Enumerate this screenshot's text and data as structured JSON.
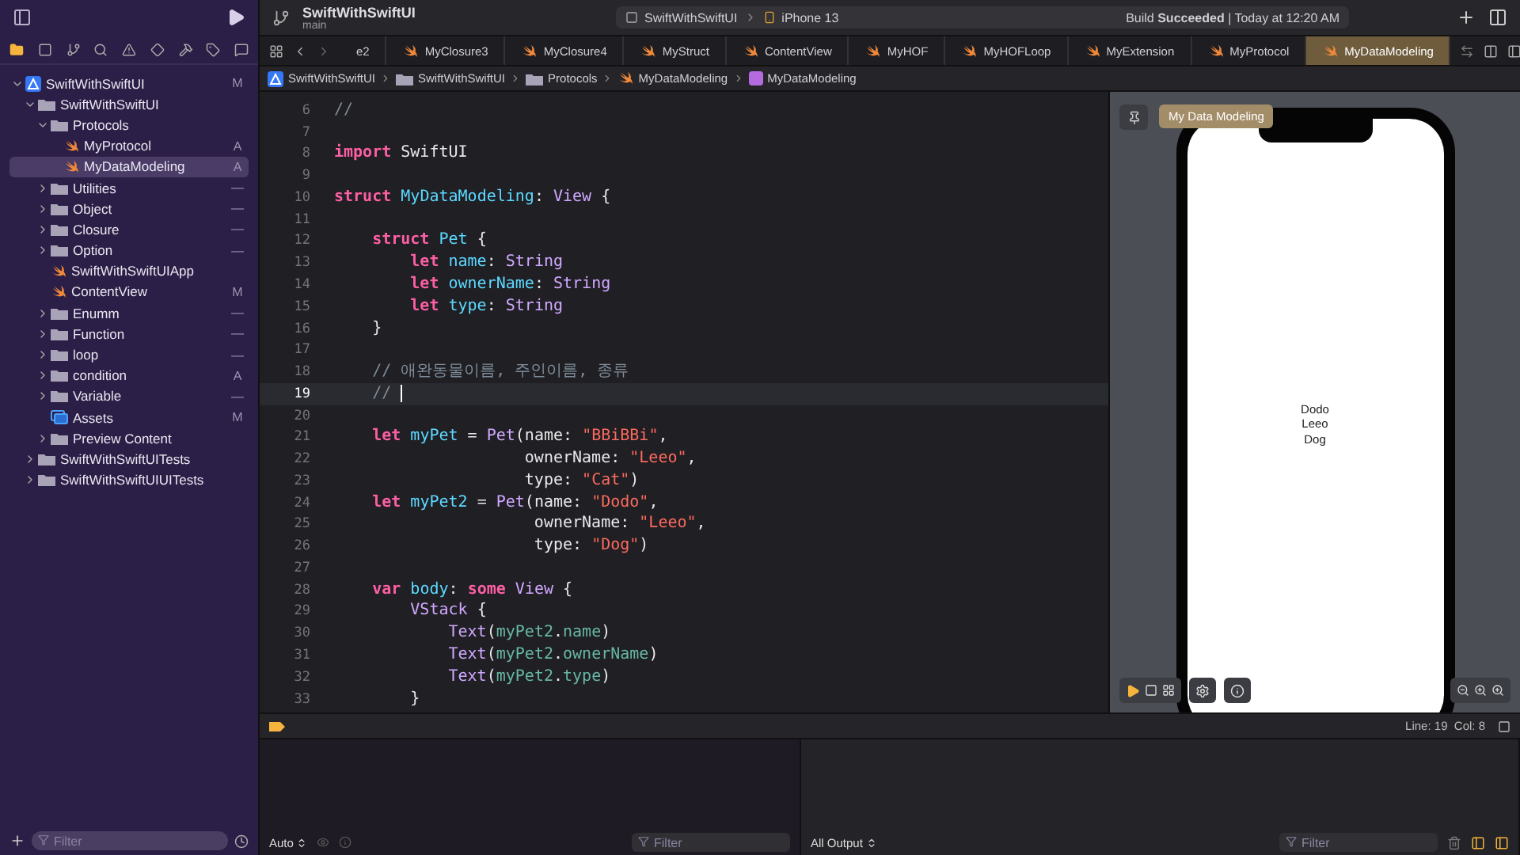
{
  "toolbar": {
    "project": "SwiftWithSwiftUI",
    "branch": "main",
    "scheme": "SwiftWithSwiftUI",
    "device": "iPhone 13",
    "status": "Build **Succeeded** | Today at 12:20 AM"
  },
  "navigator": {
    "items": [
      {
        "name": "SwiftWithSwiftUI",
        "kind": "project",
        "badge": "M",
        "expanded": true,
        "selected": false,
        "children": [
          {
            "name": "SwiftWithSwiftUI",
            "kind": "folder",
            "expanded": true,
            "selected": false,
            "children": [
              {
                "name": "Protocols",
                "kind": "folder",
                "expanded": true,
                "selected": false,
                "children": [
                  {
                    "name": "MyProtocol",
                    "kind": "swift",
                    "badge": "A",
                    "selected": false
                  },
                  {
                    "name": "MyDataModeling",
                    "kind": "swift",
                    "badge": "A",
                    "selected": true
                  }
                ]
              },
              {
                "name": "Utilities",
                "kind": "folder",
                "badge": "—",
                "expanded": false,
                "selected": false
              },
              {
                "name": "Object",
                "kind": "folder",
                "badge": "—",
                "expanded": false,
                "selected": false
              },
              {
                "name": "Closure",
                "kind": "folder",
                "badge": "—",
                "expanded": false,
                "selected": false
              },
              {
                "name": "Option",
                "kind": "folder",
                "badge": "—",
                "expanded": false,
                "selected": false
              },
              {
                "name": "SwiftWithSwiftUIApp",
                "kind": "swift",
                "selected": false
              },
              {
                "name": "ContentView",
                "kind": "swift",
                "badge": "M",
                "selected": false
              },
              {
                "name": "Enumm",
                "kind": "folder",
                "badge": "—",
                "expanded": false,
                "selected": false
              },
              {
                "name": "Function",
                "kind": "folder",
                "badge": "—",
                "expanded": false,
                "selected": false
              },
              {
                "name": "loop",
                "kind": "folder",
                "badge": "—",
                "expanded": false,
                "selected": false
              },
              {
                "name": "condition",
                "kind": "folder",
                "badge": "A",
                "expanded": false,
                "selected": false
              },
              {
                "name": "Variable",
                "kind": "folder",
                "badge": "—",
                "expanded": false,
                "selected": false
              },
              {
                "name": "Assets",
                "kind": "assets",
                "badge": "M",
                "selected": false
              },
              {
                "name": "Preview Content",
                "kind": "folder",
                "expanded": false,
                "selected": false
              }
            ]
          },
          {
            "name": "SwiftWithSwiftUITests",
            "kind": "folder",
            "expanded": false,
            "selected": false
          },
          {
            "name": "SwiftWithSwiftUIUITests",
            "kind": "folder",
            "expanded": false,
            "selected": false
          }
        ]
      }
    ],
    "filter": {
      "placeholder": "Filter"
    }
  },
  "tabs": [
    {
      "label": "e2",
      "selected": false
    },
    {
      "label": "MyClosure3",
      "selected": false
    },
    {
      "label": "MyClosure4",
      "selected": false
    },
    {
      "label": "MyStruct",
      "selected": false
    },
    {
      "label": "ContentView",
      "selected": false
    },
    {
      "label": "MyHOF",
      "selected": false
    },
    {
      "label": "MyHOFLoop",
      "selected": false
    },
    {
      "label": "MyExtension",
      "selected": false
    },
    {
      "label": "MyProtocol",
      "selected": false
    },
    {
      "label": "MyDataModeling",
      "selected": true
    }
  ],
  "breadcrumb": [
    {
      "label": "SwiftWithSwiftUI",
      "kind": "project"
    },
    {
      "label": "SwiftWithSwiftUI",
      "kind": "folder"
    },
    {
      "label": "Protocols",
      "kind": "folder"
    },
    {
      "label": "MyDataModeling",
      "kind": "swift"
    },
    {
      "label": "MyDataModeling",
      "kind": "struct"
    }
  ],
  "editor": {
    "lines": [
      {
        "number": "6",
        "current": false,
        "tokens": [
          {
            "kind": "comment",
            "text": "//"
          }
        ]
      },
      {
        "number": "7",
        "current": false
      },
      {
        "number": "8",
        "current": false,
        "tokens": [
          {
            "kind": "keyword",
            "text": "import"
          },
          {
            "kind": "plain",
            "text": " SwiftUI"
          }
        ]
      },
      {
        "number": "9",
        "current": false
      },
      {
        "number": "10",
        "current": false,
        "tokens": [
          {
            "kind": "keyword",
            "text": "struct "
          },
          {
            "kind": "decl",
            "text": "MyDataModeling"
          },
          {
            "kind": "plain",
            "text": ": "
          },
          {
            "kind": "type",
            "text": "View"
          },
          {
            "kind": "plain",
            "text": " {"
          }
        ]
      },
      {
        "number": "11",
        "current": false
      },
      {
        "number": "12",
        "current": false,
        "tokens": [
          {
            "kind": "keyword",
            "text": "    struct "
          },
          {
            "kind": "decl",
            "text": "Pet"
          },
          {
            "kind": "plain",
            "text": " {"
          }
        ]
      },
      {
        "number": "13",
        "current": false,
        "tokens": [
          {
            "kind": "keyword",
            "text": "        let "
          },
          {
            "kind": "decl",
            "text": "name"
          },
          {
            "kind": "plain",
            "text": ": "
          },
          {
            "kind": "type",
            "text": "String"
          }
        ]
      },
      {
        "number": "14",
        "current": false,
        "tokens": [
          {
            "kind": "keyword",
            "text": "        let "
          },
          {
            "kind": "decl",
            "text": "ownerName"
          },
          {
            "kind": "plain",
            "text": ": "
          },
          {
            "kind": "type",
            "text": "String"
          }
        ]
      },
      {
        "number": "15",
        "current": false,
        "tokens": [
          {
            "kind": "keyword",
            "text": "        let "
          },
          {
            "kind": "decl",
            "text": "type"
          },
          {
            "kind": "plain",
            "text": ": "
          },
          {
            "kind": "type",
            "text": "String"
          }
        ]
      },
      {
        "number": "16",
        "current": false,
        "tokens": [
          {
            "kind": "plain",
            "text": "    }"
          }
        ]
      },
      {
        "number": "17",
        "current": false
      },
      {
        "number": "18",
        "current": false,
        "tokens": [
          {
            "kind": "comment",
            "text": "    // 애완동물이름, 주인이름, 종류"
          }
        ]
      },
      {
        "number": "19",
        "current": true,
        "tokens": [
          {
            "kind": "comment",
            "text": "    // "
          }
        ]
      },
      {
        "number": "20",
        "current": false
      },
      {
        "number": "21",
        "current": false,
        "tokens": [
          {
            "kind": "keyword",
            "text": "    let "
          },
          {
            "kind": "decl",
            "text": "myPet"
          },
          {
            "kind": "plain",
            "text": " = "
          },
          {
            "kind": "type",
            "text": "Pet"
          },
          {
            "kind": "plain",
            "text": "(name: "
          },
          {
            "kind": "string",
            "text": "\"BBiBBi\""
          },
          {
            "kind": "plain",
            "text": ","
          }
        ]
      },
      {
        "number": "22",
        "current": false,
        "tokens": [
          {
            "kind": "plain",
            "text": "                    ownerName: "
          },
          {
            "kind": "string",
            "text": "\"Leeo\""
          },
          {
            "kind": "plain",
            "text": ","
          }
        ]
      },
      {
        "number": "23",
        "current": false,
        "tokens": [
          {
            "kind": "plain",
            "text": "                    type: "
          },
          {
            "kind": "string",
            "text": "\"Cat\""
          },
          {
            "kind": "plain",
            "text": ")"
          }
        ]
      },
      {
        "number": "24",
        "current": false,
        "tokens": [
          {
            "kind": "keyword",
            "text": "    let "
          },
          {
            "kind": "decl",
            "text": "myPet2"
          },
          {
            "kind": "plain",
            "text": " = "
          },
          {
            "kind": "type",
            "text": "Pet"
          },
          {
            "kind": "plain",
            "text": "(name: "
          },
          {
            "kind": "string",
            "text": "\"Dodo\""
          },
          {
            "kind": "plain",
            "text": ","
          }
        ]
      },
      {
        "number": "25",
        "current": false,
        "tokens": [
          {
            "kind": "plain",
            "text": "                     ownerName: "
          },
          {
            "kind": "string",
            "text": "\"Leeo\""
          },
          {
            "kind": "plain",
            "text": ","
          }
        ]
      },
      {
        "number": "26",
        "current": false,
        "tokens": [
          {
            "kind": "plain",
            "text": "                     type: "
          },
          {
            "kind": "string",
            "text": "\"Dog\""
          },
          {
            "kind": "plain",
            "text": ")"
          }
        ]
      },
      {
        "number": "27",
        "current": false
      },
      {
        "number": "28",
        "current": false,
        "tokens": [
          {
            "kind": "keyword",
            "text": "    var "
          },
          {
            "kind": "decl",
            "text": "body"
          },
          {
            "kind": "plain",
            "text": ": "
          },
          {
            "kind": "keyword",
            "text": "some "
          },
          {
            "kind": "type",
            "text": "View"
          },
          {
            "kind": "plain",
            "text": " {"
          }
        ]
      },
      {
        "number": "29",
        "current": false,
        "tokens": [
          {
            "kind": "type",
            "text": "        VStack"
          },
          {
            "kind": "plain",
            "text": " {"
          }
        ]
      },
      {
        "number": "30",
        "current": false,
        "tokens": [
          {
            "kind": "type",
            "text": "            Text"
          },
          {
            "kind": "plain",
            "text": "("
          },
          {
            "kind": "member",
            "text": "myPet2"
          },
          {
            "kind": "plain",
            "text": "."
          },
          {
            "kind": "member",
            "text": "name"
          },
          {
            "kind": "plain",
            "text": ")"
          }
        ]
      },
      {
        "number": "31",
        "current": false,
        "tokens": [
          {
            "kind": "type",
            "text": "            Text"
          },
          {
            "kind": "plain",
            "text": "("
          },
          {
            "kind": "member",
            "text": "myPet2"
          },
          {
            "kind": "plain",
            "text": "."
          },
          {
            "kind": "member",
            "text": "ownerName"
          },
          {
            "kind": "plain",
            "text": ")"
          }
        ]
      },
      {
        "number": "32",
        "current": false,
        "tokens": [
          {
            "kind": "type",
            "text": "            Text"
          },
          {
            "kind": "plain",
            "text": "("
          },
          {
            "kind": "member",
            "text": "myPet2"
          },
          {
            "kind": "plain",
            "text": "."
          },
          {
            "kind": "member",
            "text": "type"
          },
          {
            "kind": "plain",
            "text": ")"
          }
        ]
      },
      {
        "number": "33",
        "current": false,
        "tokens": [
          {
            "kind": "plain",
            "text": "        }"
          }
        ]
      }
    ]
  },
  "preview": {
    "label": "My Data Modeling",
    "texts": [
      "Dodo",
      "Leeo",
      "Dog"
    ]
  },
  "status_bar": {
    "position": "Line: 19  Col: 8"
  },
  "debug": {
    "variables_mode": "Auto",
    "variables_filter": {
      "placeholder": "Filter"
    },
    "output_mode": "All Output",
    "output_filter": {
      "placeholder": "Filter"
    }
  }
}
